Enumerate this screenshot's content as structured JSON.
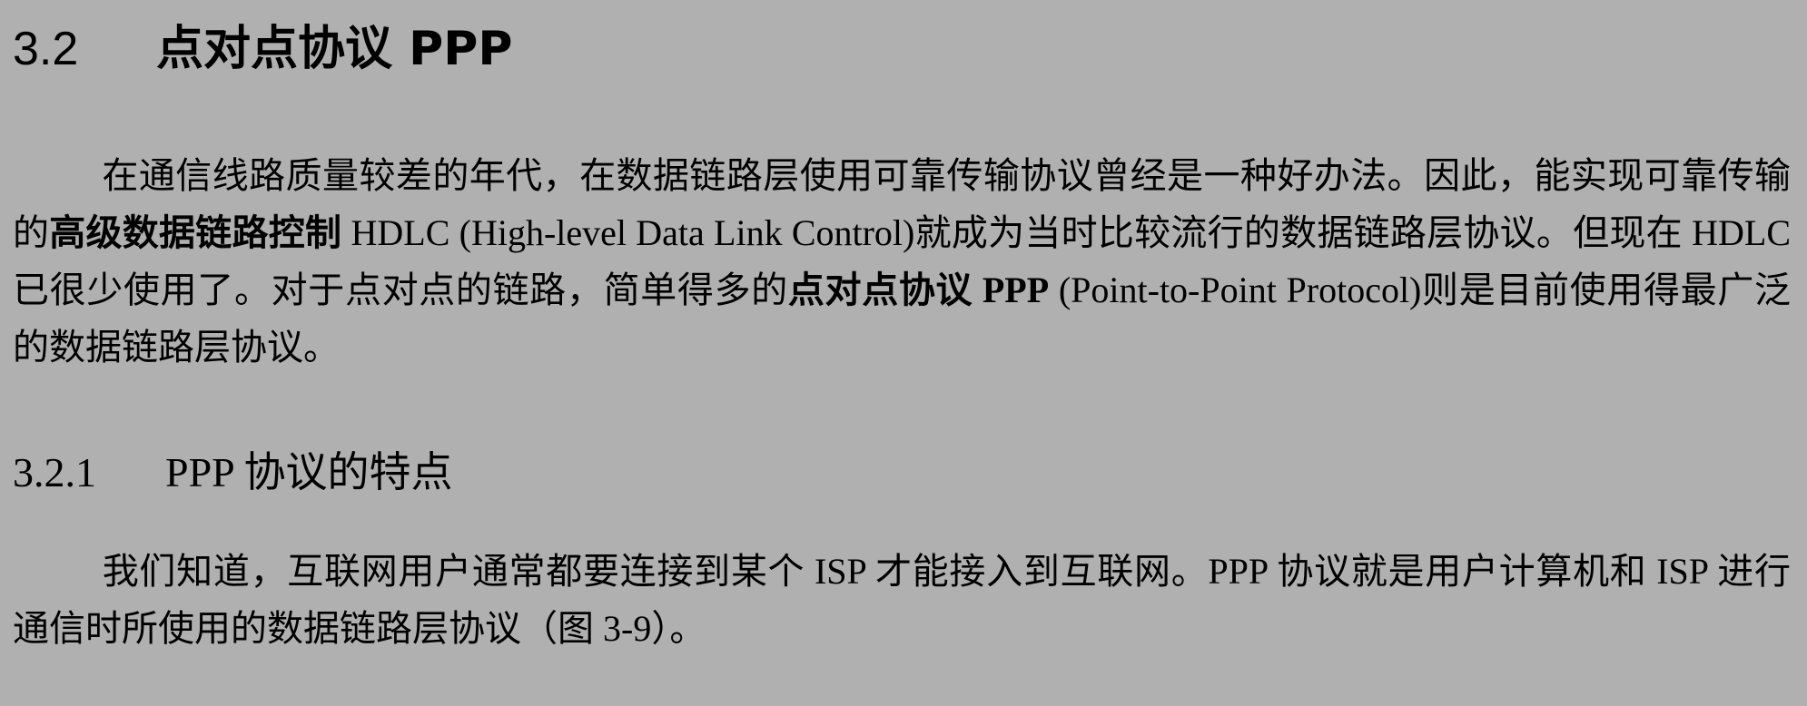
{
  "section": {
    "number": "3.2",
    "title": "点对点协议 PPP"
  },
  "para1": {
    "part1": "在通信线路质量较差的年代，在数据链路层使用可靠传输协议曾经是一种好办法。因此，能实现可靠传输的",
    "bold1": "高级数据链路控制",
    "part2": " HDLC (High-level Data Link Control)就成为当时比较流行的数据链路层协议。但现在 HDLC 已很少使用了。对于点对点的链路，简单得多的",
    "bold2": "点对点协议 PPP",
    "part3": " (Point-to-Point Protocol)则是目前使用得最广泛的数据链路层协议。"
  },
  "subsection": {
    "number": "3.2.1",
    "title": "PPP 协议的特点"
  },
  "para2": {
    "text": "我们知道，互联网用户通常都要连接到某个 ISP 才能接入到互联网。PPP 协议就是用户计算机和 ISP 进行通信时所使用的数据链路层协议（图 3-9）。"
  }
}
